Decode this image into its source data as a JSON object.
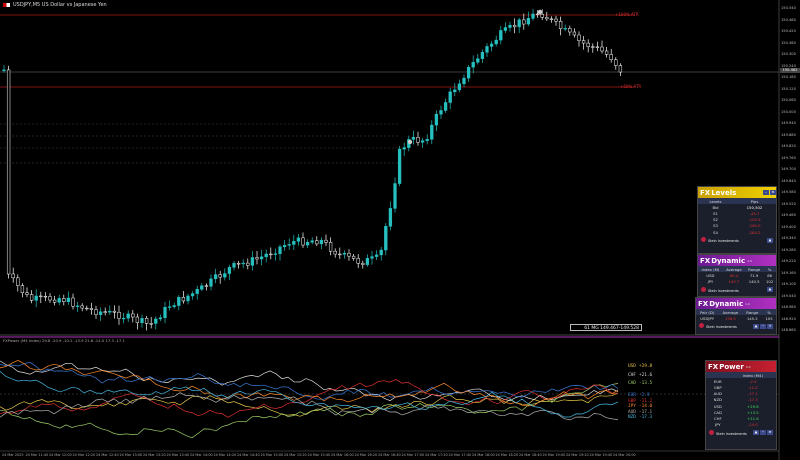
{
  "title": "USDJPY,M5 US Dollar vs Japanese Yen",
  "price_axis": [
    "150.540",
    "150.480",
    "150.420",
    "150.360",
    "150.300",
    "150.240",
    "150.180",
    "150.120",
    "150.060",
    "150.000",
    "149.940",
    "149.880",
    "149.820",
    "149.760",
    "149.700",
    "149.640",
    "149.580",
    "149.520",
    "149.460",
    "149.400",
    "149.340",
    "149.280",
    "149.220",
    "149.160",
    "149.100",
    "149.040",
    "148.980",
    "148.920",
    "148.860"
  ],
  "current_price": "150.462",
  "levels": {
    "upper": "+100% ATR",
    "lower": "+50% ATR"
  },
  "ma_label": "61 MG 149.467-149.528",
  "indicator": {
    "title": "FXPower (M4 Index) 29.8 -20.9 -10.2 -13.9 21.6 -14.0 17.3 -17.1",
    "legend": [
      {
        "name": "USD",
        "value": "+29.8",
        "color": "#e6c84a"
      },
      {
        "name": "CHF",
        "value": "+21.6",
        "color": "#dddddd"
      },
      {
        "name": "CAD",
        "value": "-13.5",
        "color": "#9fd06a"
      },
      {
        "name": "EUR",
        "value": "-2.9",
        "color": "#3a7ad8"
      },
      {
        "name": "GBP",
        "value": "-11.2",
        "color": "#e03030"
      },
      {
        "name": "JPY",
        "value": "-14.0",
        "color": "#ff8c2a"
      },
      {
        "name": "AUD",
        "value": "-17.1",
        "color": "#b0b0b0"
      },
      {
        "name": "NZD",
        "value": "-17.3",
        "color": "#46b8e0"
      }
    ]
  },
  "time_axis": [
    "24 Mar 2025",
    "24 Mar 11:40",
    "24 Mar 12:00",
    "24 Mar 12:20",
    "24 Mar 12:40",
    "24 Mar 13:00",
    "24 Mar 13:20",
    "24 Mar 13:40",
    "24 Mar 14:00",
    "24 Mar 14:20",
    "24 Mar 14:40",
    "24 Mar 15:00",
    "24 Mar 15:20",
    "24 Mar 15:40",
    "24 Mar 16:00",
    "24 Mar 16:20",
    "24 Mar 16:40",
    "24 Mar 17:00",
    "24 Mar 17:20",
    "24 Mar 17:40",
    "24 Mar 18:00",
    "24 Mar 18:20",
    "24 Mar 18:40",
    "24 Mar 19:00",
    "24 Mar 19:20",
    "24 Mar 19:40",
    "24 Mar 20:00"
  ],
  "fx_levels": {
    "brand": "FX",
    "name": "Levels",
    "headers": [
      "Levels",
      "Pips"
    ],
    "rows": [
      {
        "label": "Bid",
        "value": "150,502"
      },
      {
        "label": "S1",
        "value": "-45.7"
      },
      {
        "label": "S2",
        "value": "-102.9"
      },
      {
        "label": "S3",
        "value": "-160.0"
      },
      {
        "label": "S4",
        "value": "-284.2"
      }
    ],
    "footer": "Stein Investments"
  },
  "fx_dynamic1": {
    "brand": "FX",
    "name": "Dynamic",
    "version": "1.0",
    "headers": [
      "Index (M)",
      "Average",
      "Range",
      "%"
    ],
    "rows": [
      {
        "c1": "USD",
        "c2": "60.4",
        "c3": "71.9",
        "c4": "86"
      },
      {
        "c1": "JPY",
        "c2": "145.7",
        "c3": "140.5",
        "c4": "102"
      }
    ],
    "footer": "Stein Investments"
  },
  "fx_dynamic2": {
    "brand": "FX",
    "name": "Dynamic",
    "version": "1.0",
    "headers": [
      "Pair (D)",
      "Average",
      "Range",
      "%"
    ],
    "rows": [
      {
        "c1": "USDJPY",
        "c2": "138.5",
        "c3": "145.2",
        "c4": "105"
      }
    ],
    "footer": "Stein Investments"
  },
  "fx_power": {
    "brand": "FX",
    "name": "Power",
    "version": "4.0",
    "headers": [
      "",
      "Index (M4)"
    ],
    "rows": [
      {
        "label": "EUR",
        "value": "-2.9",
        "color": "#e03030"
      },
      {
        "label": "GBP",
        "value": "-11.2",
        "color": "#e03030"
      },
      {
        "label": "AUD",
        "value": "-17.1",
        "color": "#e03030"
      },
      {
        "label": "NZD",
        "value": "-17.3",
        "color": "#e03030"
      },
      {
        "label": "USD",
        "value": "+29.8",
        "color": "#3ddc5a"
      },
      {
        "label": "CAD",
        "value": "+13.5",
        "color": "#3ddc5a"
      },
      {
        "label": "CHF",
        "value": "+21.6",
        "color": "#3ddc5a"
      },
      {
        "label": "JPY",
        "value": "-14.0",
        "color": "#e03030"
      }
    ],
    "footer": "Stein Investments"
  },
  "colors": {
    "bull": "#27c0c0",
    "bear": "#ffffff",
    "level_line": "#b01818",
    "bg": "#000000"
  }
}
